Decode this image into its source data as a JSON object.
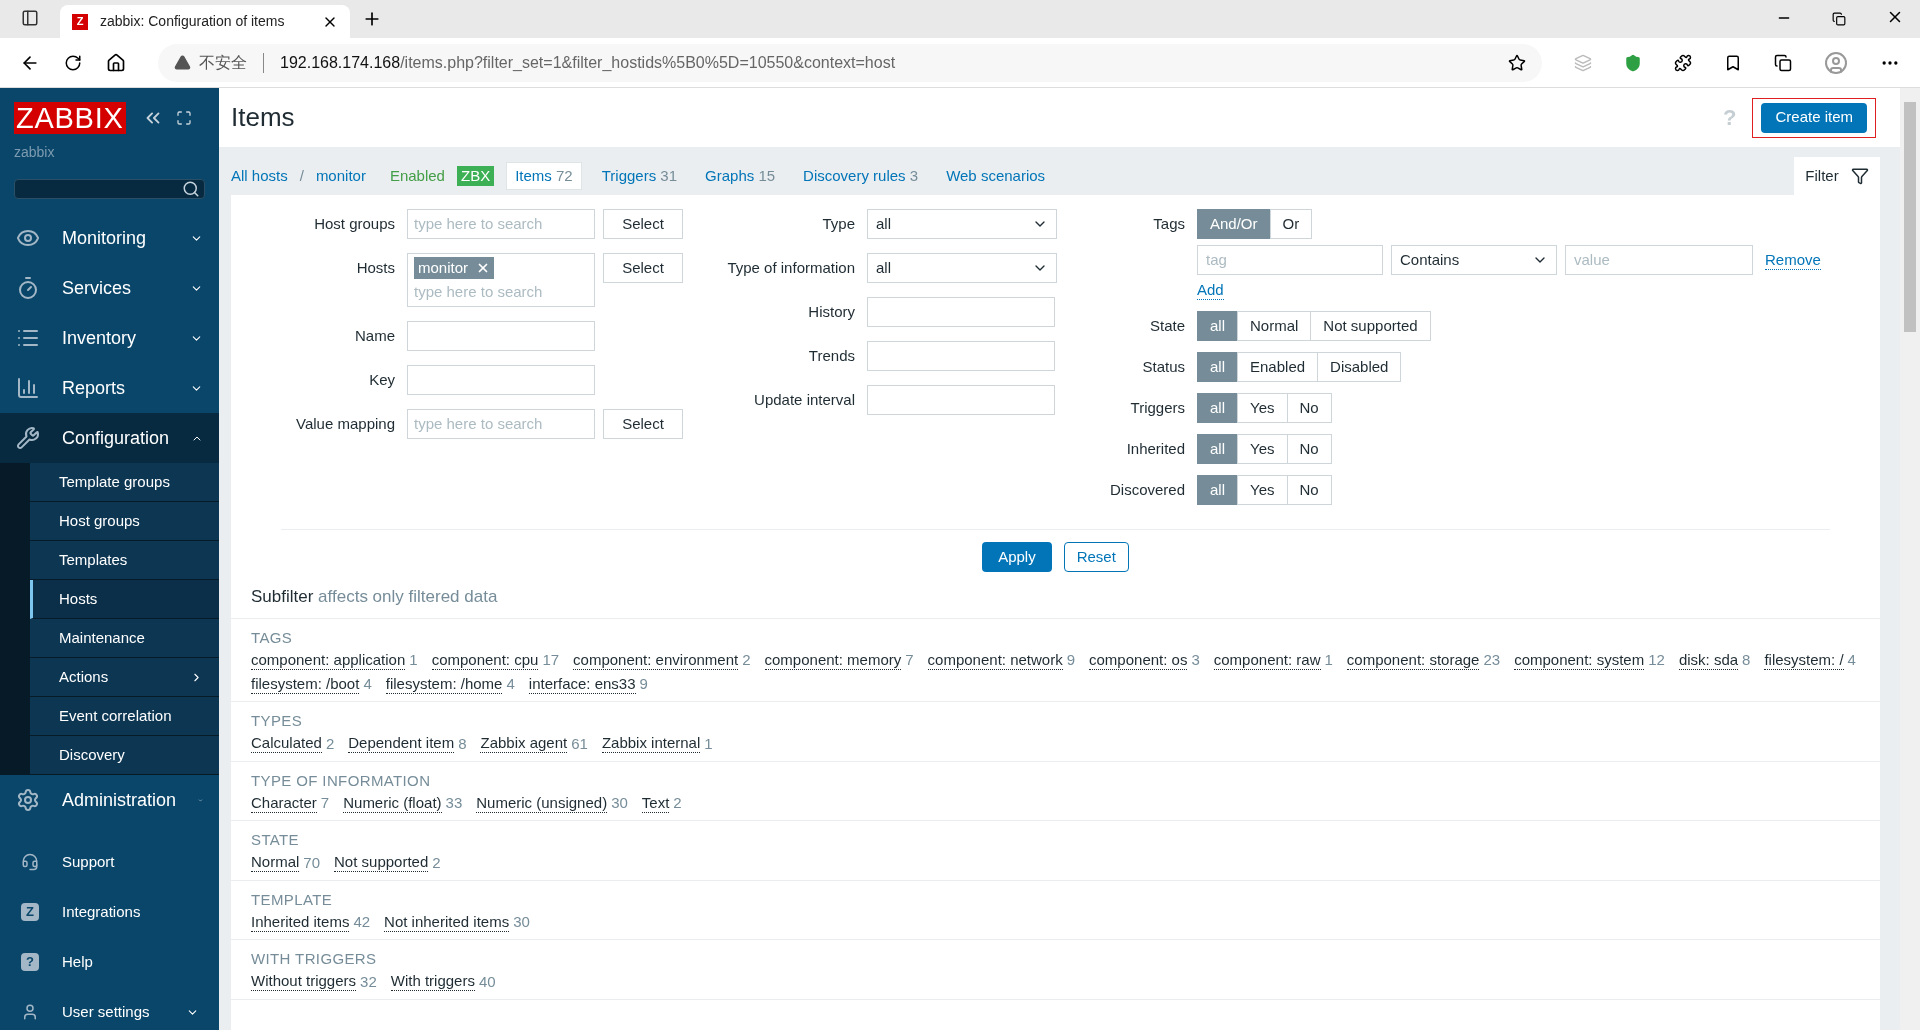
{
  "browser": {
    "tab": {
      "icon_char": "Z",
      "title": "zabbix: Configuration of items"
    },
    "address": {
      "warning": "不安全",
      "host": "192.168.174.168",
      "path": "/items.php?filter_set=1&filter_hostids%5B0%5D=10550&context=host"
    }
  },
  "sidebar": {
    "logo": "ZABBIX",
    "server": "zabbix",
    "menu": [
      {
        "kind": "eye",
        "label": "Monitoring",
        "expanded": false
      },
      {
        "kind": "timer",
        "label": "Services",
        "expanded": false
      },
      {
        "kind": "list",
        "label": "Inventory",
        "expanded": false
      },
      {
        "kind": "chart",
        "label": "Reports",
        "expanded": false
      },
      {
        "kind": "wrench",
        "label": "Configuration",
        "expanded": true,
        "children": [
          {
            "label": "Template groups",
            "selected": false
          },
          {
            "label": "Host groups",
            "selected": false
          },
          {
            "label": "Templates",
            "selected": false
          },
          {
            "label": "Hosts",
            "selected": true
          },
          {
            "label": "Maintenance",
            "selected": false
          },
          {
            "label": "Actions",
            "selected": false,
            "has_submenu": true
          },
          {
            "label": "Event correlation",
            "selected": false
          },
          {
            "label": "Discovery",
            "selected": false
          }
        ]
      },
      {
        "kind": "gear",
        "label": "Administration",
        "expanded": false
      }
    ],
    "footer": [
      {
        "kind": "headset",
        "label": "Support"
      },
      {
        "kind": "letter",
        "icon_char": "Z",
        "label": "Integrations"
      },
      {
        "kind": "letter",
        "icon_char": "?",
        "label": "Help"
      },
      {
        "kind": "user",
        "label": "User settings",
        "expanded": false
      }
    ]
  },
  "header": {
    "title": "Items",
    "help": "?",
    "create_button": {
      "label": "Create item",
      "highlighted": true
    }
  },
  "nav": {
    "breadcrumbs": [
      "All hosts",
      "monitor"
    ],
    "separator": "/",
    "status": "Enabled",
    "availability": "ZBX",
    "tabs": [
      {
        "label": "Items",
        "count": "72",
        "selected": true
      },
      {
        "label": "Triggers",
        "count": "31",
        "selected": false
      },
      {
        "label": "Graphs",
        "count": "15",
        "selected": false
      },
      {
        "label": "Discovery rules",
        "count": "3",
        "selected": false
      },
      {
        "label": "Web scenarios",
        "selected": false
      }
    ],
    "filter_tab": {
      "label": "Filter",
      "selected": true
    }
  },
  "filter": {
    "left": [
      {
        "label": "Host groups",
        "kind": "multiselect",
        "placeholder": "type here to search",
        "button": "Select"
      },
      {
        "label": "Hosts",
        "kind": "multiselect",
        "chips": [
          "monitor"
        ],
        "placeholder": "type here to search",
        "button": "Select"
      },
      {
        "label": "Name",
        "kind": "text"
      },
      {
        "label": "Key",
        "kind": "text"
      },
      {
        "label": "Value mapping",
        "kind": "multiselect",
        "placeholder": "type here to search",
        "button": "Select"
      }
    ],
    "middle": [
      {
        "label": "Type",
        "kind": "select",
        "value": "all"
      },
      {
        "label": "Type of information",
        "kind": "select",
        "value": "all"
      },
      {
        "label": "History",
        "kind": "text"
      },
      {
        "label": "Trends",
        "kind": "text"
      },
      {
        "label": "Update interval",
        "kind": "text"
      }
    ],
    "tags": {
      "label": "Tags",
      "operator": [
        {
          "label": "And/Or",
          "selected": true
        },
        {
          "label": "Or",
          "selected": false
        }
      ],
      "rows": [
        {
          "tag_placeholder": "tag",
          "operator": "Contains",
          "value_placeholder": "value",
          "remove": "Remove"
        }
      ],
      "add": "Add"
    },
    "segments": [
      {
        "label": "State",
        "options": [
          {
            "label": "all",
            "selected": true
          },
          {
            "label": "Normal",
            "selected": false
          },
          {
            "label": "Not supported",
            "selected": false
          }
        ]
      },
      {
        "label": "Status",
        "options": [
          {
            "label": "all",
            "selected": true
          },
          {
            "label": "Enabled",
            "selected": false
          },
          {
            "label": "Disabled",
            "selected": false
          }
        ]
      },
      {
        "label": "Triggers",
        "options": [
          {
            "label": "all",
            "selected": true
          },
          {
            "label": "Yes",
            "selected": false
          },
          {
            "label": "No",
            "selected": false
          }
        ]
      },
      {
        "label": "Inherited",
        "options": [
          {
            "label": "all",
            "selected": true
          },
          {
            "label": "Yes",
            "selected": false
          },
          {
            "label": "No",
            "selected": false
          }
        ]
      },
      {
        "label": "Discovered",
        "options": [
          {
            "label": "all",
            "selected": true
          },
          {
            "label": "Yes",
            "selected": false
          },
          {
            "label": "No",
            "selected": false
          }
        ]
      }
    ],
    "apply": "Apply",
    "reset": "Reset"
  },
  "subfilter": {
    "title": "Subfilter",
    "note": "affects only filtered data",
    "groups": [
      {
        "title": "TAGS",
        "items": [
          {
            "label": "component: application",
            "count": "1"
          },
          {
            "label": "component: cpu",
            "count": "17"
          },
          {
            "label": "component: environment",
            "count": "2"
          },
          {
            "label": "component: memory",
            "count": "7"
          },
          {
            "label": "component: network",
            "count": "9"
          },
          {
            "label": "component: os",
            "count": "3"
          },
          {
            "label": "component: raw",
            "count": "1"
          },
          {
            "label": "component: storage",
            "count": "23"
          },
          {
            "label": "component: system",
            "count": "12"
          },
          {
            "label": "disk: sda",
            "count": "8"
          },
          {
            "label": "filesystem: /",
            "count": "4"
          },
          {
            "label": "filesystem: /boot",
            "count": "4"
          },
          {
            "label": "filesystem: /home",
            "count": "4"
          },
          {
            "label": "interface: ens33",
            "count": "9"
          }
        ]
      },
      {
        "title": "TYPES",
        "items": [
          {
            "label": "Calculated",
            "count": "2"
          },
          {
            "label": "Dependent item",
            "count": "8"
          },
          {
            "label": "Zabbix agent",
            "count": "61"
          },
          {
            "label": "Zabbix internal",
            "count": "1"
          }
        ]
      },
      {
        "title": "TYPE OF INFORMATION",
        "items": [
          {
            "label": "Character",
            "count": "7"
          },
          {
            "label": "Numeric (float)",
            "count": "33"
          },
          {
            "label": "Numeric (unsigned)",
            "count": "30"
          },
          {
            "label": "Text",
            "count": "2"
          }
        ]
      },
      {
        "title": "STATE",
        "items": [
          {
            "label": "Normal",
            "count": "70"
          },
          {
            "label": "Not supported",
            "count": "2"
          }
        ]
      },
      {
        "title": "TEMPLATE",
        "items": [
          {
            "label": "Inherited items",
            "count": "42"
          },
          {
            "label": "Not inherited items",
            "count": "30"
          }
        ]
      },
      {
        "title": "WITH TRIGGERS",
        "items": [
          {
            "label": "Without triggers",
            "count": "32"
          },
          {
            "label": "With triggers",
            "count": "40"
          }
        ]
      }
    ]
  }
}
